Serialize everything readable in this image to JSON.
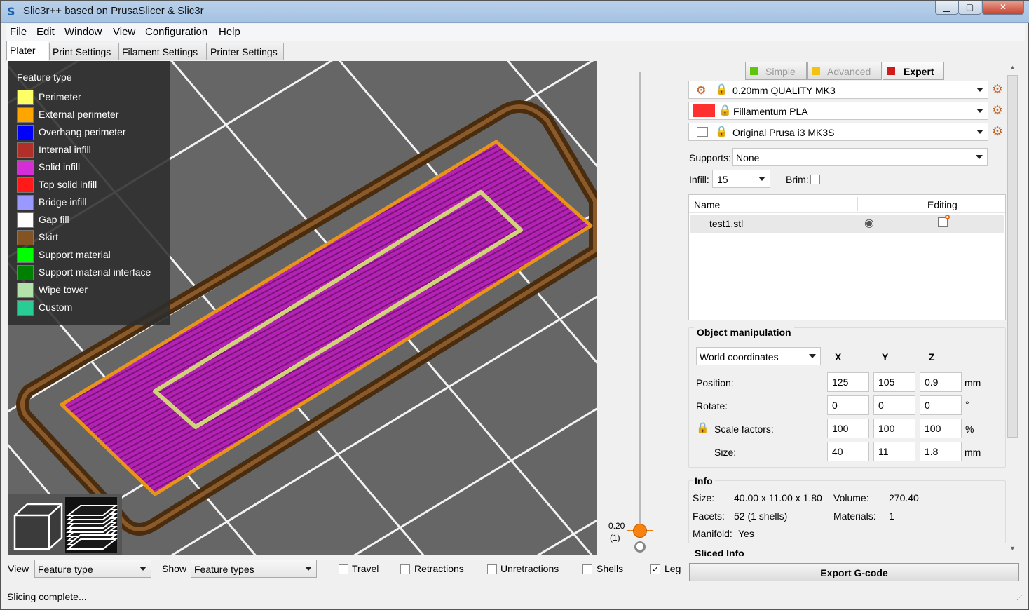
{
  "window": {
    "title": "Slic3r++ based on PrusaSlicer & Slic3r",
    "minimize_glyph": "▁",
    "maximize_glyph": "▢",
    "close_glyph": "✕"
  },
  "menu": [
    "File",
    "Edit",
    "Window",
    "View",
    "Configuration",
    "Help"
  ],
  "tabs": [
    "Plater",
    "Print Settings",
    "Filament Settings",
    "Printer Settings"
  ],
  "legend": {
    "title": "Feature type",
    "items": [
      {
        "label": "Perimeter",
        "color": "#ffff66"
      },
      {
        "label": "External perimeter",
        "color": "#ffa500"
      },
      {
        "label": "Overhang perimeter",
        "color": "#0000ff"
      },
      {
        "label": "Internal infill",
        "color": "#b03029"
      },
      {
        "label": "Solid infill",
        "color": "#d62ed6"
      },
      {
        "label": "Top solid infill",
        "color": "#ff1a1a"
      },
      {
        "label": "Bridge infill",
        "color": "#9999ff"
      },
      {
        "label": "Gap fill",
        "color": "#ffffff"
      },
      {
        "label": "Skirt",
        "color": "#845321"
      },
      {
        "label": "Support material",
        "color": "#00ff00"
      },
      {
        "label": "Support material interface",
        "color": "#008000"
      },
      {
        "label": "Wipe tower",
        "color": "#b3e3ab"
      },
      {
        "label": "Custom",
        "color": "#28cc94"
      }
    ]
  },
  "layer_slider": {
    "value": "0.20",
    "index": "(1)"
  },
  "mode": {
    "simple": {
      "label": "Simple",
      "color": "#5ec40c"
    },
    "advanced": {
      "label": "Advanced",
      "color": "#f4c20d"
    },
    "expert": {
      "label": "Expert",
      "color": "#d11b1b"
    }
  },
  "presets": {
    "print": "0.20mm QUALITY MK3",
    "filament": "Fillamentum PLA",
    "filament_color": "#ff3030",
    "printer": "Original Prusa i3 MK3S"
  },
  "supports": {
    "label": "Supports:",
    "value": "None"
  },
  "infill": {
    "label": "Infill:",
    "value": "15"
  },
  "brim": {
    "label": "Brim:",
    "checked": false
  },
  "object_list": {
    "col_name": "Name",
    "col_editing": "Editing",
    "objects": [
      {
        "name": "test1.stl"
      }
    ]
  },
  "object_manipulation": {
    "title": "Object manipulation",
    "coord_system": "World coordinates",
    "axes": [
      "X",
      "Y",
      "Z"
    ],
    "rows": [
      {
        "label": "Position:",
        "values": [
          "125",
          "105",
          "0.9"
        ],
        "unit": "mm"
      },
      {
        "label": "Rotate:",
        "values": [
          "0",
          "0",
          "0"
        ],
        "unit": "°"
      },
      {
        "label": "Scale factors:",
        "values": [
          "100",
          "100",
          "100"
        ],
        "unit": "%"
      },
      {
        "label": "Size:",
        "values": [
          "40",
          "11",
          "1.8"
        ],
        "unit": "mm"
      }
    ]
  },
  "info": {
    "title": "Info",
    "size_label": "Size:",
    "size": "40.00 x 11.00 x 1.80",
    "volume_label": "Volume:",
    "volume": "270.40",
    "facets_label": "Facets:",
    "facets": "52 (1 shells)",
    "materials_label": "Materials:",
    "materials": "1",
    "manifold_label": "Manifold:",
    "manifold": "Yes"
  },
  "sliced_info": {
    "title": "Sliced Info"
  },
  "export_button": "Export G-code",
  "bottom_bar": {
    "view_label": "View",
    "view_value": "Feature type",
    "show_label": "Show",
    "show_value": "Feature types",
    "checkboxes": [
      {
        "label": "Travel",
        "checked": false
      },
      {
        "label": "Retractions",
        "checked": false
      },
      {
        "label": "Unretractions",
        "checked": false
      },
      {
        "label": "Shells",
        "checked": false
      },
      {
        "label": "Leg",
        "checked": true
      }
    ]
  },
  "status": "Slicing complete..."
}
